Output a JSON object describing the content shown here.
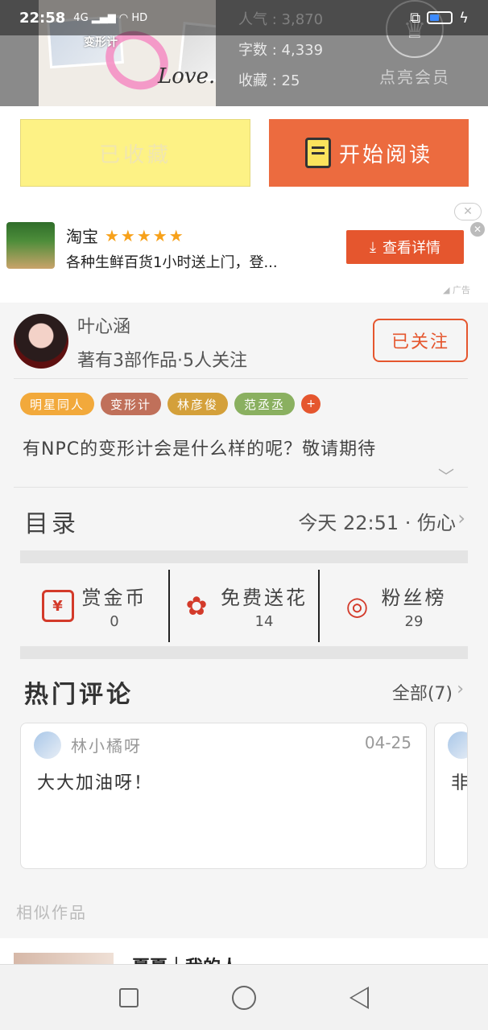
{
  "status_bar": {
    "time": "22:58",
    "signal": "4G",
    "network": "HD"
  },
  "book": {
    "cover_tag": "变形计",
    "cover_script": "Love.",
    "stats": [
      {
        "label": "人气",
        "value": "3,870"
      },
      {
        "label": "字数",
        "value": "4,339"
      },
      {
        "label": "收藏",
        "value": "25"
      }
    ],
    "vip_label": "点亮会员"
  },
  "actions": {
    "favorited_label": "已收藏",
    "read_label": "开始阅读"
  },
  "ad": {
    "title": "淘宝",
    "stars": "★★★★★",
    "description": "各种生鲜百货1小时送上门，登...",
    "cta_label": "查看详情",
    "close_label": "✕",
    "ad_label": "广告"
  },
  "author": {
    "name": "叶心涵",
    "meta": "著有3部作品·5人关注",
    "follow_label": "已关注"
  },
  "tags": [
    {
      "label": "明星同人",
      "color": "#f2a93b"
    },
    {
      "label": "变形计",
      "color": "#c0705a"
    },
    {
      "label": "林彦俊",
      "color": "#d4a03a"
    },
    {
      "label": "范丞丞",
      "color": "#8ab060"
    }
  ],
  "tags_more": "+",
  "description": "有NPC的变形计会是什么样的呢？敬请期待",
  "toc": {
    "label": "目录",
    "latest": "今天 22:51 · 伤心"
  },
  "rewards": [
    {
      "label": "赏金币",
      "value": "0",
      "icon": "¥"
    },
    {
      "label": "免费送花",
      "value": "14",
      "icon": "✿"
    },
    {
      "label": "粉丝榜",
      "value": "29",
      "icon": "◎"
    }
  ],
  "comments_section": {
    "label": "热门评论",
    "all_label": "全部(7)"
  },
  "comments": [
    {
      "user": "林小橘呀",
      "date": "04-25",
      "body": "大大加油呀！"
    },
    {
      "user": "",
      "date": "",
      "body": "非"
    }
  ],
  "similar": {
    "label": "相似作品",
    "first_title": "夏夏｜我的人"
  },
  "colors": {
    "accent": "#e5562e",
    "fav_button": "#fdf285",
    "read_button": "#ec6b3f"
  }
}
